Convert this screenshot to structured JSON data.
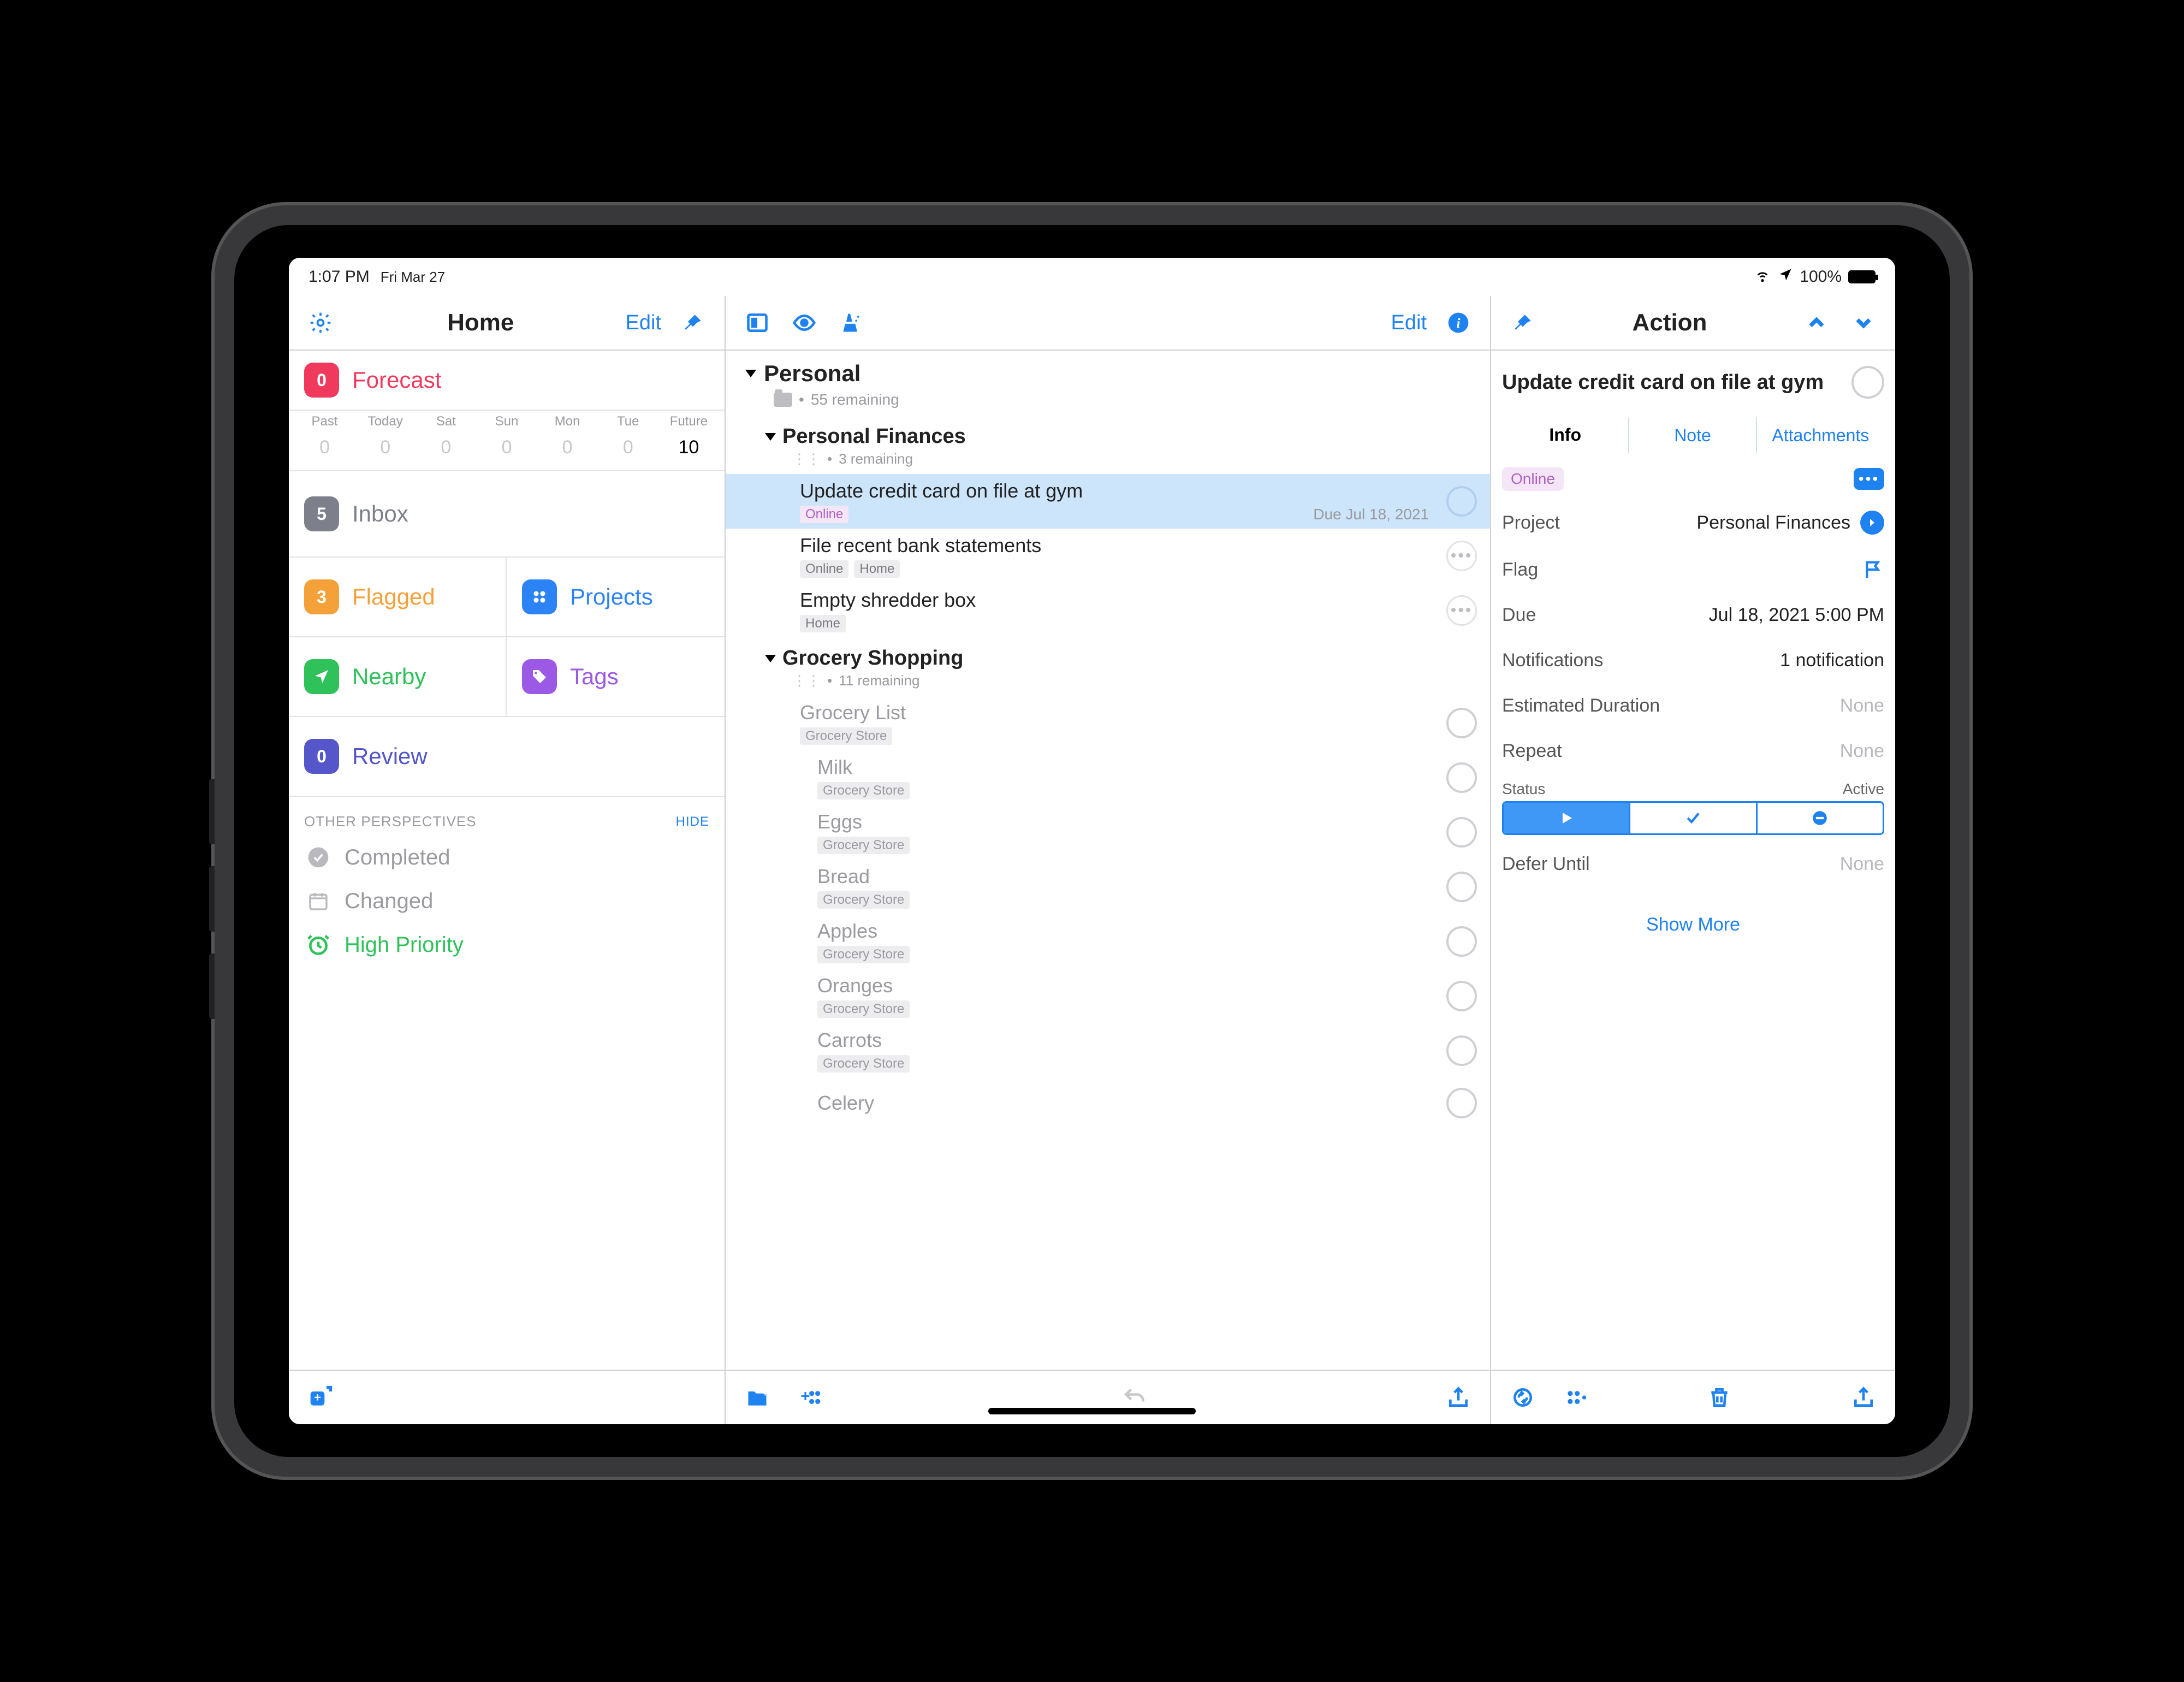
{
  "statusbar": {
    "time": "1:07 PM",
    "date": "Fri Mar 27",
    "battery": "100%"
  },
  "col1": {
    "title": "Home",
    "edit": "Edit",
    "forecast": {
      "label": "Forecast",
      "count": "0"
    },
    "fc_days": [
      {
        "lbl": "Past",
        "val": "0"
      },
      {
        "lbl": "Today",
        "val": "0"
      },
      {
        "lbl": "Sat",
        "val": "0"
      },
      {
        "lbl": "Sun",
        "val": "0"
      },
      {
        "lbl": "Mon",
        "val": "0"
      },
      {
        "lbl": "Tue",
        "val": "0"
      },
      {
        "lbl": "Future",
        "val": "10",
        "active": true
      }
    ],
    "inbox": {
      "label": "Inbox",
      "count": "5"
    },
    "flagged": {
      "label": "Flagged",
      "count": "3"
    },
    "projects": {
      "label": "Projects"
    },
    "nearby": {
      "label": "Nearby"
    },
    "tags": {
      "label": "Tags"
    },
    "review": {
      "label": "Review",
      "count": "0"
    },
    "other_header": "OTHER PERSPECTIVES",
    "hide": "HIDE",
    "completed": "Completed",
    "changed": "Changed",
    "high_priority": "High Priority"
  },
  "col2": {
    "edit": "Edit",
    "group": {
      "title": "Personal",
      "remaining": "55 remaining"
    },
    "proj1": {
      "title": "Personal Finances",
      "remaining": "3 remaining"
    },
    "proj2": {
      "title": "Grocery Shopping",
      "remaining": "11 remaining"
    },
    "tasks1": [
      {
        "title": "Update credit card on file at gym",
        "tags": [
          "Online"
        ],
        "due": "Due Jul 18, 2021",
        "selected": true
      },
      {
        "title": "File recent bank statements",
        "tags": [
          "Online",
          "Home"
        ],
        "more": true
      },
      {
        "title": "Empty shredder box",
        "tags": [
          "Home"
        ],
        "more": true
      }
    ],
    "glist": {
      "title": "Grocery List",
      "tag": "Grocery Store"
    },
    "gitems": [
      "Milk",
      "Eggs",
      "Bread",
      "Apples",
      "Oranges",
      "Carrots",
      "Celery"
    ],
    "gtag": "Grocery Store"
  },
  "col3": {
    "title": "Action",
    "task_title": "Update credit card on file at gym",
    "tabs": {
      "info": "Info",
      "note": "Note",
      "attachments": "Attachments"
    },
    "tag": "Online",
    "project": {
      "k": "Project",
      "v": "Personal Finances"
    },
    "flag": {
      "k": "Flag"
    },
    "due": {
      "k": "Due",
      "v": "Jul 18, 2021  5:00 PM"
    },
    "notifications": {
      "k": "Notifications",
      "v": "1 notification"
    },
    "duration": {
      "k": "Estimated Duration",
      "v": "None"
    },
    "repeat": {
      "k": "Repeat",
      "v": "None"
    },
    "status": {
      "k": "Status",
      "v": "Active"
    },
    "defer": {
      "k": "Defer Until",
      "v": "None"
    },
    "show_more": "Show More"
  }
}
